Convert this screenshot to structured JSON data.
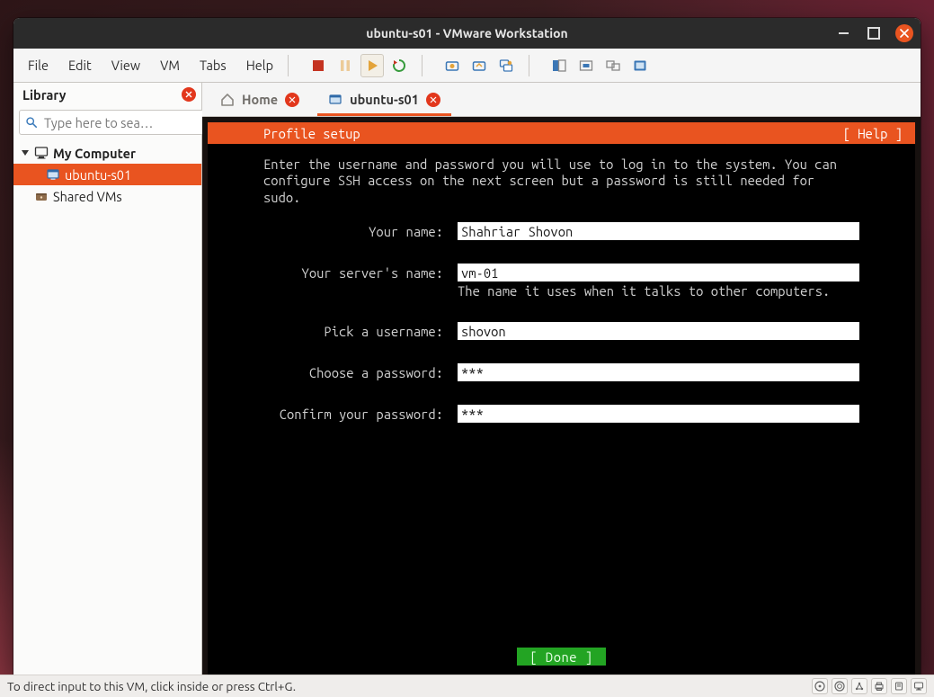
{
  "window": {
    "title": "ubuntu-s01 - VMware Workstation"
  },
  "menubar": {
    "items": [
      "File",
      "Edit",
      "View",
      "VM",
      "Tabs",
      "Help"
    ]
  },
  "sidebar": {
    "title": "Library",
    "search_placeholder": "Type here to sea…",
    "items": [
      {
        "label": "My Computer",
        "depth": 0,
        "type": "computer",
        "open": true,
        "selected": false
      },
      {
        "label": "ubuntu-s01",
        "depth": 1,
        "type": "vm",
        "selected": true
      },
      {
        "label": "Shared VMs",
        "depth": 0,
        "type": "shared",
        "selected": false
      }
    ]
  },
  "tabs": {
    "items": [
      {
        "label": "Home",
        "type": "home",
        "closable": true,
        "active": false
      },
      {
        "label": "ubuntu-s01",
        "type": "vm",
        "closable": true,
        "active": true
      }
    ]
  },
  "console": {
    "header_title": "Profile setup",
    "header_help": "[ Help ]",
    "description": "Enter the username and password you will use to log in to the system. You can\nconfigure SSH access on the next screen but a password is still needed for\nsudo.",
    "fields": {
      "your_name": {
        "label": "Your name:",
        "value": "Shahriar Shovon"
      },
      "server_name": {
        "label": "Your server's name:",
        "value": "vm-01",
        "hint": "The name it uses when it talks to other computers."
      },
      "username": {
        "label": "Pick a username:",
        "value": "shovon"
      },
      "password": {
        "label": "Choose a password:",
        "value": "***"
      },
      "password_confirm": {
        "label": "Confirm your password:",
        "value": "***"
      }
    },
    "done_label": "[ Done         ]"
  },
  "statusbar": {
    "hint": "To direct input to this VM, click inside or press Ctrl+G."
  }
}
